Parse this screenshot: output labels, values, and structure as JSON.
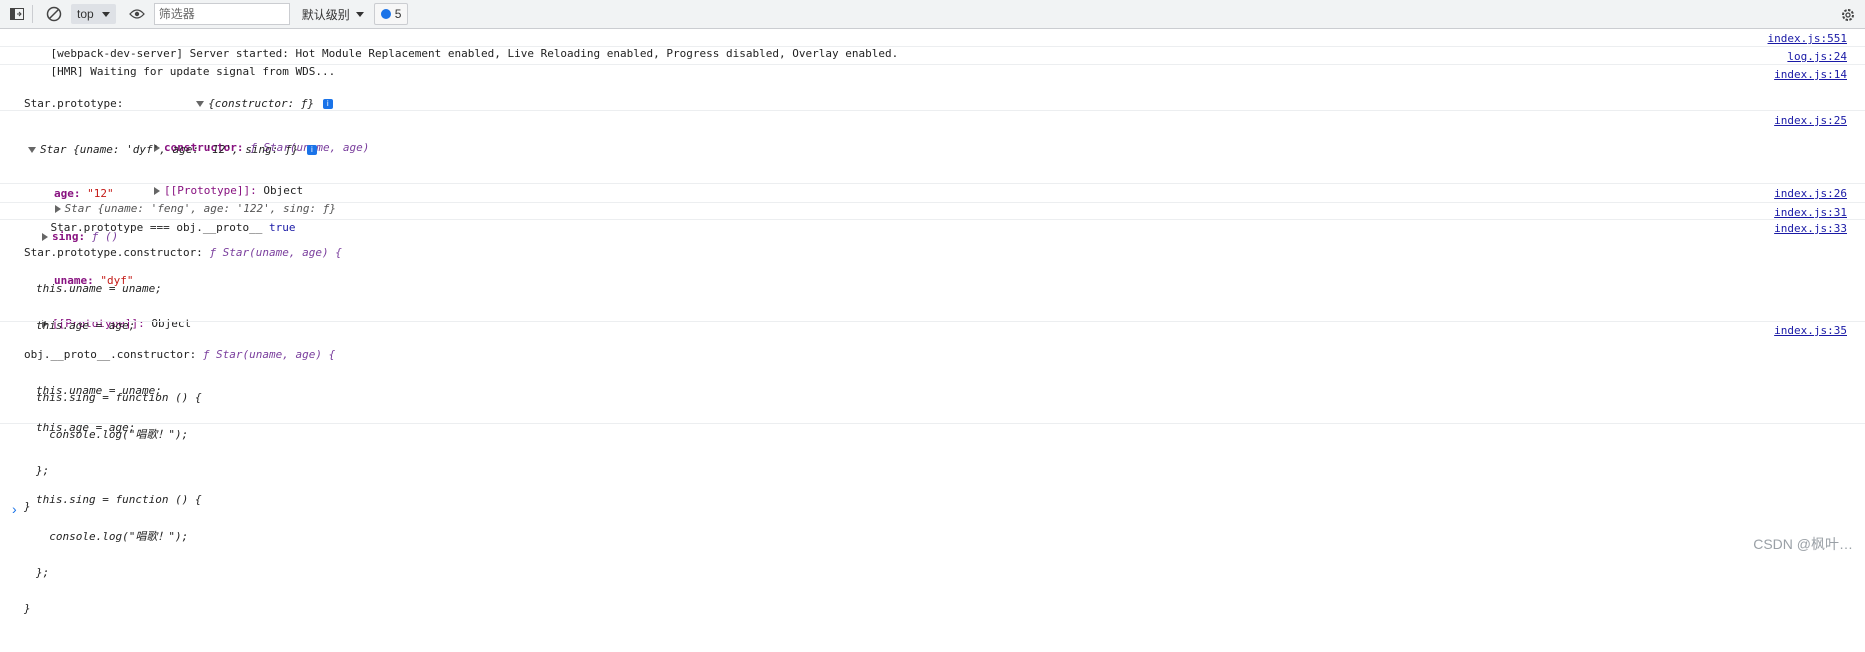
{
  "toolbar": {
    "context": "top",
    "filter_placeholder": "筛选器",
    "levels": "默认级别",
    "issues_count": "5"
  },
  "logs": [
    {
      "text": "[webpack-dev-server] Server started: Hot Module Replacement enabled, Live Reloading enabled, Progress disabled, Overlay enabled.",
      "source": "index.js:551"
    },
    {
      "text": "[HMR] Waiting for update signal from WDS...",
      "source": "log.js:24"
    }
  ],
  "proto_log": {
    "label": "Star.prototype:",
    "summary": "{constructor: ƒ}",
    "constructor_key": "constructor:",
    "constructor_val": "ƒ Star(uname, age)",
    "proto_key": "[[Prototype]]:",
    "proto_val": "Object",
    "source": "index.js:14"
  },
  "star1": {
    "summary": "Star {uname: 'dyf', age: '12', sing: ƒ}",
    "age_key": "age:",
    "age_val": "\"12\"",
    "sing_key": "sing:",
    "sing_val": "ƒ ()",
    "uname_key": "uname:",
    "uname_val": "\"dyf\"",
    "proto_key": "[[Prototype]]:",
    "proto_val": "Object",
    "source": "index.js:25"
  },
  "star2": {
    "summary": "Star {uname: 'feng', age: '122', sing: ƒ}",
    "source": "index.js:26"
  },
  "compare": {
    "text": "Star.prototype === obj.__proto__",
    "value": "true",
    "source": "index.js:31"
  },
  "ctor1": {
    "label": "Star.prototype.constructor:",
    "head": "ƒ Star(uname, age) {",
    "lines": [
      "this.uname = uname;",
      "this.age = age;",
      "",
      "this.sing = function () {",
      "  console.log(\"唱歌！\");",
      "};",
      "}"
    ],
    "source": "index.js:33"
  },
  "ctor2": {
    "label": "obj.__proto__.constructor:",
    "head": "ƒ Star(uname, age) {",
    "lines": [
      "this.uname = uname;",
      "this.age = age;",
      "",
      "this.sing = function () {",
      "  console.log(\"唱歌！\");",
      "};",
      "}"
    ],
    "source": "index.js:35"
  },
  "prompt": "›",
  "watermark": "CSDN @枫叶…"
}
